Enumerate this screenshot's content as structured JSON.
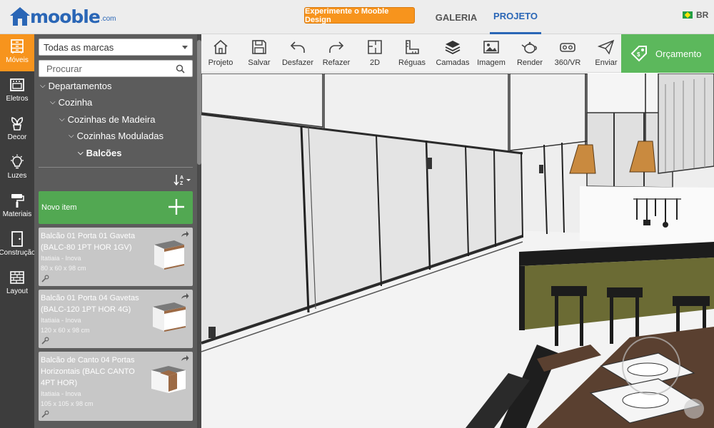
{
  "header": {
    "logo_text": "mooble",
    "logo_suffix": ".com",
    "promo_button": "Experimente o Mooble Design",
    "tabs": [
      {
        "label": "GALERIA",
        "active": false
      },
      {
        "label": "PROJETO",
        "active": true
      }
    ],
    "language": "BR"
  },
  "categories": [
    {
      "label": "Móveis",
      "icon": "dresser-icon",
      "active": true
    },
    {
      "label": "Eletros",
      "icon": "oven-icon",
      "active": false
    },
    {
      "label": "Decor",
      "icon": "plant-icon",
      "active": false
    },
    {
      "label": "Luzes",
      "icon": "lightbulb-icon",
      "active": false
    },
    {
      "label": "Materiais",
      "icon": "paint-roller-icon",
      "active": false
    },
    {
      "label": "Construção",
      "icon": "door-icon",
      "active": false
    },
    {
      "label": "Layout",
      "icon": "brick-wall-icon",
      "active": false
    }
  ],
  "panel": {
    "brand_select": "Todas as marcas",
    "search_placeholder": "Procurar",
    "tree": [
      {
        "label": "Departamentos",
        "level": 0
      },
      {
        "label": "Cozinha",
        "level": 1
      },
      {
        "label": "Cozinhas de Madeira",
        "level": 2
      },
      {
        "label": "Cozinhas Moduladas",
        "level": 3
      },
      {
        "label": "Balcões",
        "level": 4
      }
    ],
    "new_item_label": "Novo item",
    "items": [
      {
        "title": "Balcão 01 Porta 01 Gaveta (BALC-80 1PT HOR 1GV)",
        "brand": "Itatiaia - Inova",
        "dimensions": "80 x 60 x 98 cm"
      },
      {
        "title": "Balcão 01 Porta 04 Gavetas (BALC-120 1PT HOR 4G)",
        "brand": "Itatiaia - Inova",
        "dimensions": "120 x 60 x 98 cm"
      },
      {
        "title": "Balcão de Canto 04 Portas Horizontais (BALC CANTO 4PT HOR)",
        "brand": "Itatiaia - Inova",
        "dimensions": "105 x 105 x 98 cm"
      }
    ]
  },
  "toolbar": {
    "tools": [
      {
        "label": "Projeto",
        "icon": "home-icon"
      },
      {
        "label": "Salvar",
        "icon": "save-icon"
      },
      {
        "label": "Desfazer",
        "icon": "undo-icon"
      },
      {
        "label": "Refazer",
        "icon": "redo-icon"
      },
      {
        "label": "2D",
        "icon": "floorplan-icon"
      },
      {
        "label": "Réguas",
        "icon": "ruler-icon"
      },
      {
        "label": "Camadas",
        "icon": "layers-icon"
      },
      {
        "label": "Imagem",
        "icon": "image-icon"
      },
      {
        "label": "Render",
        "icon": "teapot-icon"
      },
      {
        "label": "360/VR",
        "icon": "vr-headset-icon"
      },
      {
        "label": "Enviar",
        "icon": "send-icon"
      }
    ],
    "quote_button": "Orçamento"
  },
  "colors": {
    "brand_blue": "#2a66b6",
    "accent_orange": "#f7941d",
    "accent_green": "#5cb85c",
    "sidebar_dark": "#3d3d3d",
    "panel_gray": "#5c5c5c"
  }
}
